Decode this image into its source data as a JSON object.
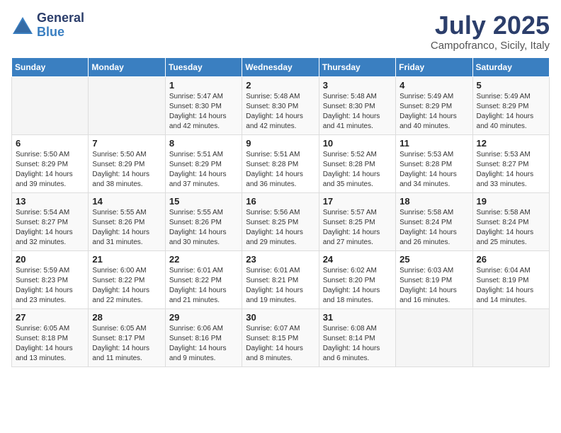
{
  "header": {
    "logo_general": "General",
    "logo_blue": "Blue",
    "month_title": "July 2025",
    "location": "Campofranco, Sicily, Italy"
  },
  "calendar": {
    "days_of_week": [
      "Sunday",
      "Monday",
      "Tuesday",
      "Wednesday",
      "Thursday",
      "Friday",
      "Saturday"
    ],
    "weeks": [
      [
        {
          "day": "",
          "info": ""
        },
        {
          "day": "",
          "info": ""
        },
        {
          "day": "1",
          "info": "Sunrise: 5:47 AM\nSunset: 8:30 PM\nDaylight: 14 hours\nand 42 minutes."
        },
        {
          "day": "2",
          "info": "Sunrise: 5:48 AM\nSunset: 8:30 PM\nDaylight: 14 hours\nand 42 minutes."
        },
        {
          "day": "3",
          "info": "Sunrise: 5:48 AM\nSunset: 8:30 PM\nDaylight: 14 hours\nand 41 minutes."
        },
        {
          "day": "4",
          "info": "Sunrise: 5:49 AM\nSunset: 8:29 PM\nDaylight: 14 hours\nand 40 minutes."
        },
        {
          "day": "5",
          "info": "Sunrise: 5:49 AM\nSunset: 8:29 PM\nDaylight: 14 hours\nand 40 minutes."
        }
      ],
      [
        {
          "day": "6",
          "info": "Sunrise: 5:50 AM\nSunset: 8:29 PM\nDaylight: 14 hours\nand 39 minutes."
        },
        {
          "day": "7",
          "info": "Sunrise: 5:50 AM\nSunset: 8:29 PM\nDaylight: 14 hours\nand 38 minutes."
        },
        {
          "day": "8",
          "info": "Sunrise: 5:51 AM\nSunset: 8:29 PM\nDaylight: 14 hours\nand 37 minutes."
        },
        {
          "day": "9",
          "info": "Sunrise: 5:51 AM\nSunset: 8:28 PM\nDaylight: 14 hours\nand 36 minutes."
        },
        {
          "day": "10",
          "info": "Sunrise: 5:52 AM\nSunset: 8:28 PM\nDaylight: 14 hours\nand 35 minutes."
        },
        {
          "day": "11",
          "info": "Sunrise: 5:53 AM\nSunset: 8:28 PM\nDaylight: 14 hours\nand 34 minutes."
        },
        {
          "day": "12",
          "info": "Sunrise: 5:53 AM\nSunset: 8:27 PM\nDaylight: 14 hours\nand 33 minutes."
        }
      ],
      [
        {
          "day": "13",
          "info": "Sunrise: 5:54 AM\nSunset: 8:27 PM\nDaylight: 14 hours\nand 32 minutes."
        },
        {
          "day": "14",
          "info": "Sunrise: 5:55 AM\nSunset: 8:26 PM\nDaylight: 14 hours\nand 31 minutes."
        },
        {
          "day": "15",
          "info": "Sunrise: 5:55 AM\nSunset: 8:26 PM\nDaylight: 14 hours\nand 30 minutes."
        },
        {
          "day": "16",
          "info": "Sunrise: 5:56 AM\nSunset: 8:25 PM\nDaylight: 14 hours\nand 29 minutes."
        },
        {
          "day": "17",
          "info": "Sunrise: 5:57 AM\nSunset: 8:25 PM\nDaylight: 14 hours\nand 27 minutes."
        },
        {
          "day": "18",
          "info": "Sunrise: 5:58 AM\nSunset: 8:24 PM\nDaylight: 14 hours\nand 26 minutes."
        },
        {
          "day": "19",
          "info": "Sunrise: 5:58 AM\nSunset: 8:24 PM\nDaylight: 14 hours\nand 25 minutes."
        }
      ],
      [
        {
          "day": "20",
          "info": "Sunrise: 5:59 AM\nSunset: 8:23 PM\nDaylight: 14 hours\nand 23 minutes."
        },
        {
          "day": "21",
          "info": "Sunrise: 6:00 AM\nSunset: 8:22 PM\nDaylight: 14 hours\nand 22 minutes."
        },
        {
          "day": "22",
          "info": "Sunrise: 6:01 AM\nSunset: 8:22 PM\nDaylight: 14 hours\nand 21 minutes."
        },
        {
          "day": "23",
          "info": "Sunrise: 6:01 AM\nSunset: 8:21 PM\nDaylight: 14 hours\nand 19 minutes."
        },
        {
          "day": "24",
          "info": "Sunrise: 6:02 AM\nSunset: 8:20 PM\nDaylight: 14 hours\nand 18 minutes."
        },
        {
          "day": "25",
          "info": "Sunrise: 6:03 AM\nSunset: 8:19 PM\nDaylight: 14 hours\nand 16 minutes."
        },
        {
          "day": "26",
          "info": "Sunrise: 6:04 AM\nSunset: 8:19 PM\nDaylight: 14 hours\nand 14 minutes."
        }
      ],
      [
        {
          "day": "27",
          "info": "Sunrise: 6:05 AM\nSunset: 8:18 PM\nDaylight: 14 hours\nand 13 minutes."
        },
        {
          "day": "28",
          "info": "Sunrise: 6:05 AM\nSunset: 8:17 PM\nDaylight: 14 hours\nand 11 minutes."
        },
        {
          "day": "29",
          "info": "Sunrise: 6:06 AM\nSunset: 8:16 PM\nDaylight: 14 hours\nand 9 minutes."
        },
        {
          "day": "30",
          "info": "Sunrise: 6:07 AM\nSunset: 8:15 PM\nDaylight: 14 hours\nand 8 minutes."
        },
        {
          "day": "31",
          "info": "Sunrise: 6:08 AM\nSunset: 8:14 PM\nDaylight: 14 hours\nand 6 minutes."
        },
        {
          "day": "",
          "info": ""
        },
        {
          "day": "",
          "info": ""
        }
      ]
    ]
  }
}
